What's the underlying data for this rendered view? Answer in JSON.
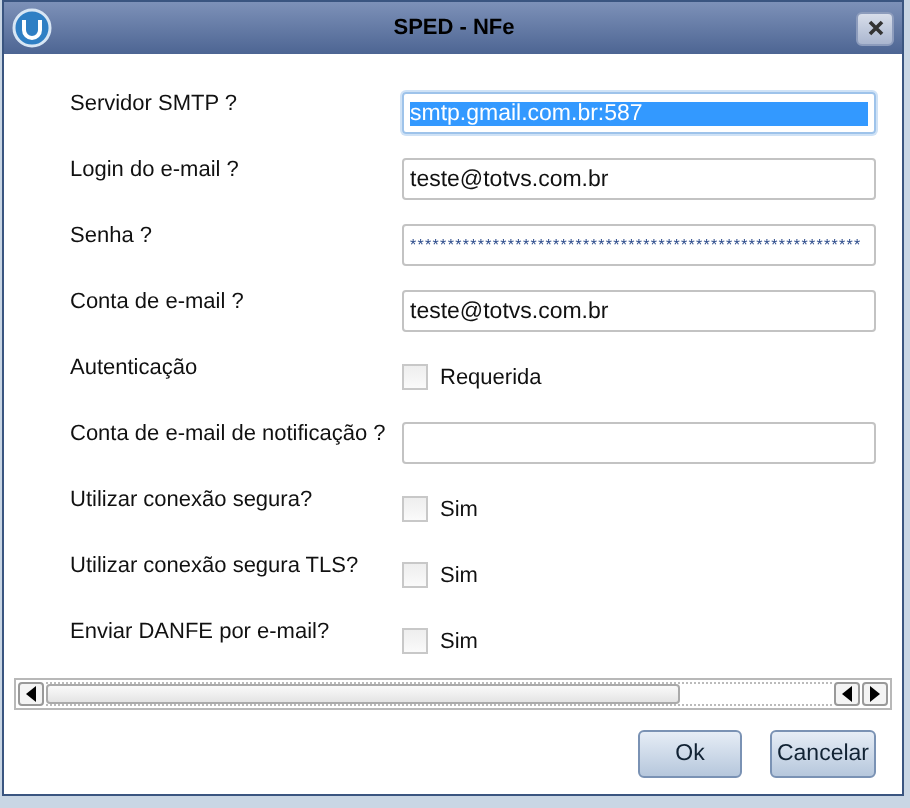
{
  "window": {
    "title": "SPED - NFe"
  },
  "fields": [
    {
      "kind": "text",
      "label": "Servidor SMTP ?",
      "value": "smtp.gmail.com.br:587",
      "selected": true
    },
    {
      "kind": "text",
      "label": "Login do e-mail ?",
      "value": "teste@totvs.com.br",
      "selected": false
    },
    {
      "kind": "text",
      "label": "Senha ?",
      "value": "************************************************************",
      "selected": false
    },
    {
      "kind": "text",
      "label": "Conta de e-mail ?",
      "value": "teste@totvs.com.br",
      "selected": false
    },
    {
      "kind": "check",
      "label": "Autenticação",
      "option": "Requerida",
      "checked": false
    },
    {
      "kind": "text",
      "label": "Conta de e-mail de notificação ?",
      "selected": false
    },
    {
      "kind": "check",
      "label": "Utilizar conexão segura?",
      "option": "Sim",
      "checked": false
    },
    {
      "kind": "check",
      "label": "Utilizar conexão segura TLS?",
      "option": "Sim",
      "checked": false
    },
    {
      "kind": "check",
      "label": "Enviar DANFE por e-mail?",
      "option": "Sim",
      "checked": false
    }
  ],
  "buttons": [
    "Ok",
    "Cancelar"
  ]
}
